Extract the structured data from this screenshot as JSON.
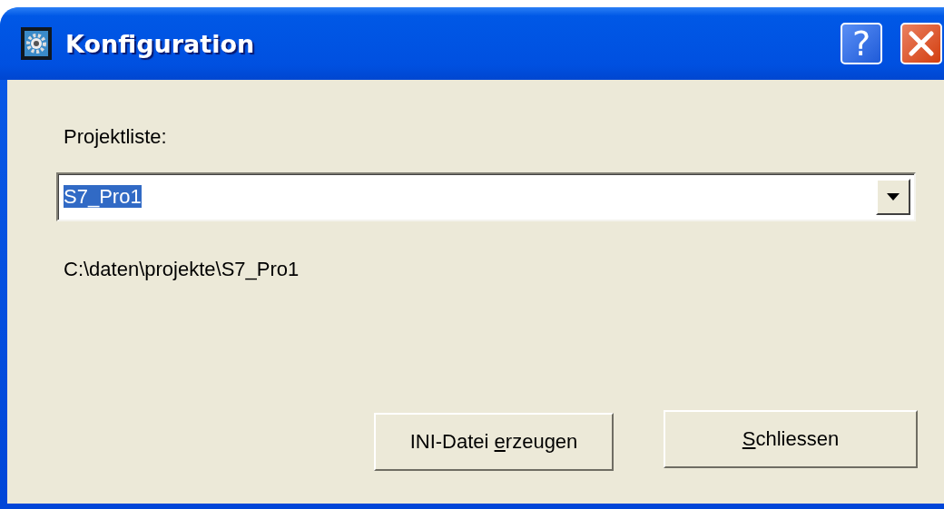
{
  "window": {
    "title": "Konfiguration"
  },
  "title_buttons": [
    {
      "kind": "help",
      "label": "?"
    },
    {
      "kind": "close"
    }
  ],
  "project_list": {
    "label": "Projektliste:",
    "value": "S7_Pro1",
    "text_selected": true
  },
  "path": "C:\\daten\\projekte\\S7_Pro1",
  "buttons": [
    {
      "label_before": "INI-Datei ",
      "access_key": "e",
      "label_after": "rzeugen"
    },
    {
      "access_key": "S",
      "label_after": "chliessen"
    }
  ]
}
